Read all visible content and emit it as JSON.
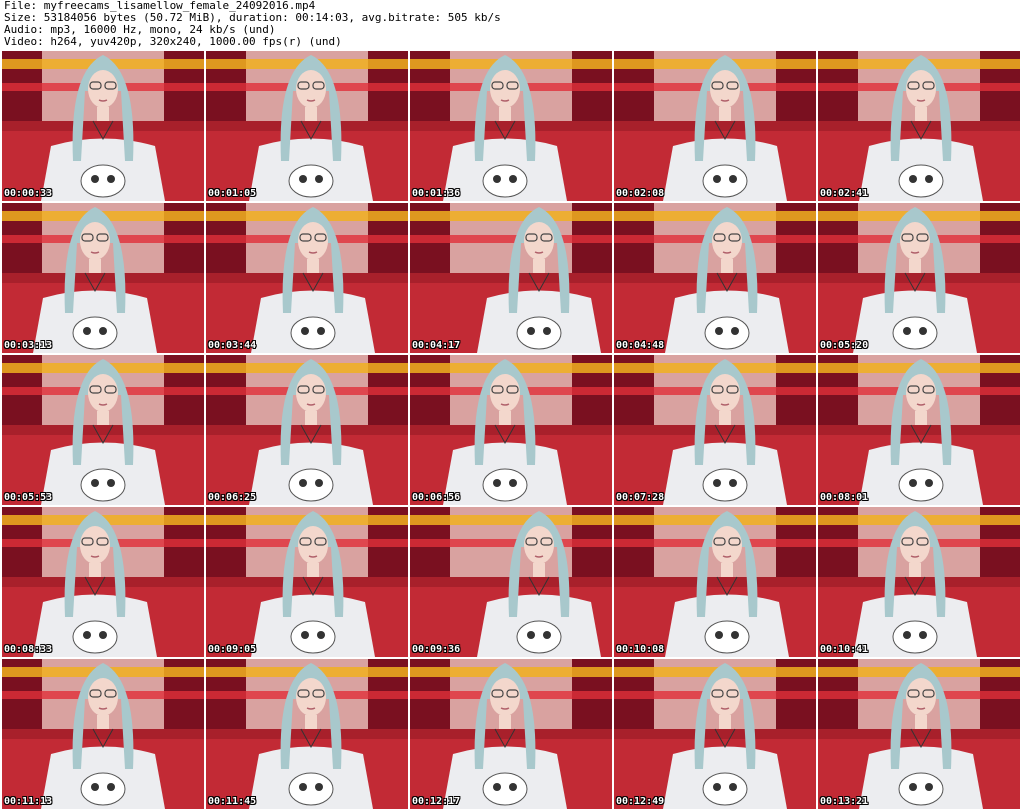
{
  "header": {
    "file_line": "File: myfreecams_lisamellow_female_24092016.mp4",
    "size_line": "Size: 53184056 bytes (50.72 MiB), duration: 00:14:03, avg.bitrate: 505 kb/s",
    "audio_line": "Audio: mp3, 16000 Hz, mono, 24 kb/s (und)",
    "video_line": "Video: h264, yuv420p, 320x240, 1000.00 fps(r) (und)"
  },
  "colors": {
    "background": "#ffffff",
    "couch": "#c22a35",
    "curtain": "#7a1020",
    "wall": "#d9a2a0",
    "garland": "#f0b020",
    "hair": "#a8c8cc",
    "shirt": "#ecedf0",
    "skin": "#f3d7cc",
    "timestamp": "#ffffff"
  },
  "thumbnails": [
    {
      "time": "00:00:33"
    },
    {
      "time": "00:01:05"
    },
    {
      "time": "00:01:36"
    },
    {
      "time": "00:02:08"
    },
    {
      "time": "00:02:41"
    },
    {
      "time": "00:03:13"
    },
    {
      "time": "00:03:44"
    },
    {
      "time": "00:04:17"
    },
    {
      "time": "00:04:48"
    },
    {
      "time": "00:05:20"
    },
    {
      "time": "00:05:53"
    },
    {
      "time": "00:06:25"
    },
    {
      "time": "00:06:56"
    },
    {
      "time": "00:07:28"
    },
    {
      "time": "00:08:01"
    },
    {
      "time": "00:08:33"
    },
    {
      "time": "00:09:05"
    },
    {
      "time": "00:09:36"
    },
    {
      "time": "00:10:08"
    },
    {
      "time": "00:10:41"
    },
    {
      "time": "00:11:13"
    },
    {
      "time": "00:11:45"
    },
    {
      "time": "00:12:17"
    },
    {
      "time": "00:12:49"
    },
    {
      "time": "00:13:21"
    }
  ]
}
